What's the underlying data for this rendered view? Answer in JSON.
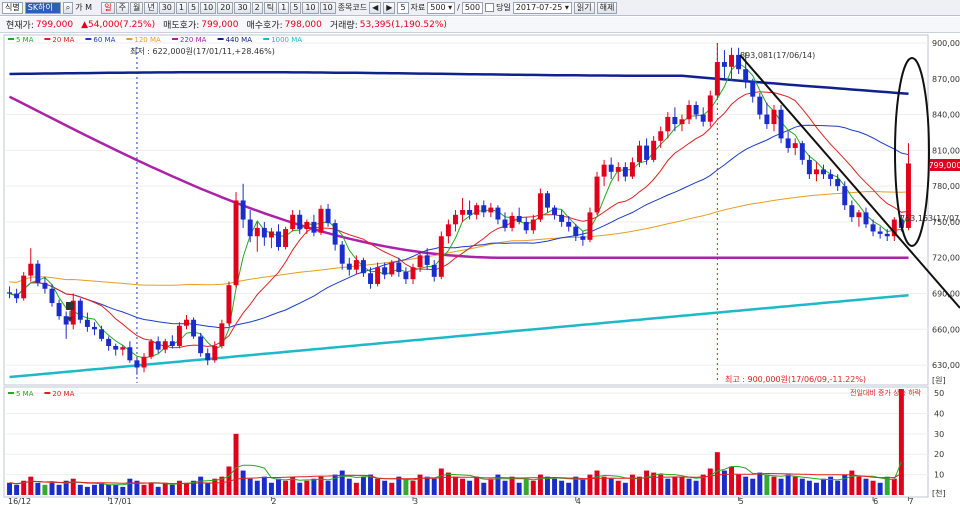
{
  "toolbar": {
    "code_label": "식별",
    "code_value": "SK하이",
    "name_short": "가 M",
    "periods": [
      "일",
      "주",
      "월",
      "년",
      "30",
      "1",
      "5",
      "10",
      "20",
      "30",
      "2",
      "틱",
      "1",
      "5",
      "10",
      "10"
    ],
    "stock_code_label": "종목코드",
    "count_value": "5",
    "data_label": "자료",
    "data_value": "500",
    "page_value": "500",
    "date_label": "당일",
    "date_value": "2017-07-25",
    "btn_save": "읽기",
    "btn_cancel": "해제"
  },
  "infobar": {
    "current_label": "현재가:",
    "current_value": "799,000",
    "change_value": "▲54,000(7.25%)",
    "ask_label": "매도호가:",
    "ask_value": "799,000",
    "bid_label": "매수호가:",
    "bid_value": "798,000",
    "volume_label": "거래량:",
    "volume_value": "53,395(1,190.52%)"
  },
  "legend_price": [
    {
      "label": "5 MA",
      "color": "#22aa22"
    },
    {
      "label": "20 MA",
      "color": "#dd2222"
    },
    {
      "label": "60 MA",
      "color": "#1a3cc8"
    },
    {
      "label": "120 MA",
      "color": "#e89c1f"
    },
    {
      "label": "220 MA",
      "color": "#aa22aa"
    },
    {
      "label": "440 MA",
      "color": "#10208e"
    },
    {
      "label": "1000 MA",
      "color": "#1fb8c8"
    }
  ],
  "legend_volume": [
    {
      "label": "5 MA",
      "color": "#22aa22"
    },
    {
      "label": "20 MA",
      "color": "#dd2222"
    }
  ],
  "annotations": {
    "low": "최저 : 622,000원(17/01/11,+28.46%)",
    "high": "최고 : 900,000원(17/06/09,-11.22%)",
    "peak_tag": "893,081(17/06/14)",
    "current_tag": "753,163(17/07/20)",
    "price_box": "799,000",
    "vol_unit": "[천]",
    "vol_header": "전일대비  증가  상승  하락",
    "price_unit": "[원]"
  },
  "chart_data": {
    "type": "candlestick",
    "y_axis": {
      "min": 615000,
      "max": 905000,
      "ticks": [
        900000,
        870000,
        840000,
        810000,
        780000,
        750000,
        720000,
        690000,
        660000,
        630000
      ]
    },
    "volume_axis": {
      "min": 0,
      "max": 52,
      "ticks": [
        50,
        40,
        30,
        20,
        10
      ]
    },
    "x_labels": [
      "16/12",
      "17/01",
      "2",
      "3",
      "4",
      "5",
      "6",
      "7"
    ],
    "ohlc": [
      [
        691000,
        696000,
        686000,
        690000
      ],
      [
        690000,
        694000,
        682000,
        686000
      ],
      [
        686000,
        708000,
        684000,
        705000
      ],
      [
        705000,
        728000,
        700000,
        715000
      ],
      [
        715000,
        718000,
        696000,
        699000
      ],
      [
        699000,
        704000,
        690000,
        694000
      ],
      [
        694000,
        698000,
        679000,
        682000
      ],
      [
        682000,
        685000,
        668000,
        671000
      ],
      [
        671000,
        675000,
        652000,
        664000
      ],
      [
        664000,
        690000,
        660000,
        684000
      ],
      [
        684000,
        686000,
        665000,
        668000
      ],
      [
        668000,
        674000,
        658000,
        662000
      ],
      [
        662000,
        666000,
        655000,
        660000
      ],
      [
        660000,
        663000,
        650000,
        652000
      ],
      [
        652000,
        654000,
        642000,
        646000
      ],
      [
        646000,
        648000,
        638000,
        643000
      ],
      [
        643000,
        647000,
        638000,
        645000
      ],
      [
        645000,
        650000,
        632000,
        634000
      ],
      [
        634000,
        637000,
        622000,
        628000
      ],
      [
        628000,
        640000,
        624000,
        637000
      ],
      [
        637000,
        652000,
        635000,
        650000
      ],
      [
        650000,
        654000,
        640000,
        643000
      ],
      [
        643000,
        652000,
        640000,
        650000
      ],
      [
        650000,
        655000,
        644000,
        646000
      ],
      [
        646000,
        666000,
        644000,
        663000
      ],
      [
        663000,
        672000,
        660000,
        668000
      ],
      [
        668000,
        670000,
        652000,
        654000
      ],
      [
        654000,
        657000,
        637000,
        640000
      ],
      [
        640000,
        644000,
        630000,
        634000
      ],
      [
        634000,
        650000,
        632000,
        646000
      ],
      [
        646000,
        668000,
        644000,
        665000
      ],
      [
        665000,
        700000,
        663000,
        697000
      ],
      [
        697000,
        775000,
        695000,
        768000
      ],
      [
        768000,
        782000,
        745000,
        752000
      ],
      [
        752000,
        760000,
        733000,
        738000
      ],
      [
        738000,
        750000,
        725000,
        745000
      ],
      [
        745000,
        750000,
        730000,
        737000
      ],
      [
        737000,
        745000,
        728000,
        742000
      ],
      [
        742000,
        748000,
        726000,
        729000
      ],
      [
        729000,
        746000,
        727000,
        744000
      ],
      [
        744000,
        760000,
        742000,
        756000
      ],
      [
        756000,
        760000,
        740000,
        744000
      ],
      [
        744000,
        752000,
        740000,
        750000
      ],
      [
        750000,
        756000,
        738000,
        741000
      ],
      [
        741000,
        764000,
        739000,
        761000
      ],
      [
        761000,
        765000,
        746000,
        749000
      ],
      [
        749000,
        752000,
        726000,
        731000
      ],
      [
        731000,
        734000,
        710000,
        715000
      ],
      [
        715000,
        720000,
        705000,
        710000
      ],
      [
        710000,
        722000,
        706000,
        718000
      ],
      [
        718000,
        720000,
        704000,
        707000
      ],
      [
        707000,
        712000,
        694000,
        698000
      ],
      [
        698000,
        716000,
        696000,
        712000
      ],
      [
        712000,
        716000,
        702000,
        706000
      ],
      [
        706000,
        718000,
        704000,
        716000
      ],
      [
        716000,
        720000,
        704000,
        708000
      ],
      [
        708000,
        712000,
        698000,
        702000
      ],
      [
        702000,
        715000,
        698000,
        712000
      ],
      [
        712000,
        725000,
        708000,
        722000
      ],
      [
        722000,
        728000,
        710000,
        714000
      ],
      [
        714000,
        718000,
        700000,
        704000
      ],
      [
        704000,
        742000,
        702000,
        738000
      ],
      [
        738000,
        752000,
        732000,
        748000
      ],
      [
        748000,
        760000,
        742000,
        756000
      ],
      [
        756000,
        770000,
        750000,
        760000
      ],
      [
        760000,
        768000,
        752000,
        756000
      ],
      [
        756000,
        766000,
        752000,
        764000
      ],
      [
        764000,
        768000,
        754000,
        758000
      ],
      [
        758000,
        766000,
        754000,
        762000
      ],
      [
        762000,
        764000,
        748000,
        752000
      ],
      [
        752000,
        758000,
        742000,
        745000
      ],
      [
        745000,
        758000,
        742000,
        755000
      ],
      [
        755000,
        762000,
        748000,
        750000
      ],
      [
        750000,
        754000,
        740000,
        743000
      ],
      [
        743000,
        756000,
        740000,
        752000
      ],
      [
        752000,
        778000,
        750000,
        774000
      ],
      [
        774000,
        776000,
        758000,
        762000
      ],
      [
        762000,
        764000,
        752000,
        756000
      ],
      [
        756000,
        760000,
        746000,
        750000
      ],
      [
        750000,
        755000,
        742000,
        746000
      ],
      [
        746000,
        748000,
        734000,
        738000
      ],
      [
        738000,
        742000,
        730000,
        735000
      ],
      [
        735000,
        762000,
        733000,
        758000
      ],
      [
        758000,
        792000,
        756000,
        788000
      ],
      [
        788000,
        802000,
        780000,
        798000
      ],
      [
        798000,
        804000,
        786000,
        792000
      ],
      [
        792000,
        800000,
        784000,
        796000
      ],
      [
        796000,
        800000,
        784000,
        788000
      ],
      [
        788000,
        804000,
        786000,
        800000
      ],
      [
        800000,
        818000,
        796000,
        814000
      ],
      [
        814000,
        820000,
        798000,
        802000
      ],
      [
        802000,
        822000,
        800000,
        818000
      ],
      [
        818000,
        830000,
        812000,
        826000
      ],
      [
        826000,
        842000,
        820000,
        838000
      ],
      [
        838000,
        846000,
        826000,
        832000
      ],
      [
        832000,
        840000,
        826000,
        836000
      ],
      [
        836000,
        852000,
        832000,
        848000
      ],
      [
        848000,
        851000,
        836000,
        840000
      ],
      [
        840000,
        846000,
        830000,
        834000
      ],
      [
        834000,
        860000,
        830000,
        856000
      ],
      [
        856000,
        900000,
        854000,
        884000
      ],
      [
        884000,
        894000,
        870000,
        880000
      ],
      [
        880000,
        896000,
        868000,
        890000
      ],
      [
        890000,
        896000,
        874000,
        878000
      ],
      [
        878000,
        892000,
        862000,
        868000
      ],
      [
        868000,
        870000,
        850000,
        855000
      ],
      [
        855000,
        858000,
        836000,
        840000
      ],
      [
        840000,
        850000,
        828000,
        832000
      ],
      [
        832000,
        848000,
        826000,
        844000
      ],
      [
        844000,
        848000,
        816000,
        820000
      ],
      [
        820000,
        826000,
        808000,
        812000
      ],
      [
        812000,
        820000,
        806000,
        816000
      ],
      [
        816000,
        818000,
        798000,
        802000
      ],
      [
        802000,
        806000,
        786000,
        790000
      ],
      [
        790000,
        800000,
        784000,
        794000
      ],
      [
        794000,
        798000,
        786000,
        790000
      ],
      [
        790000,
        794000,
        780000,
        786000
      ],
      [
        786000,
        790000,
        776000,
        780000
      ],
      [
        780000,
        784000,
        760000,
        764000
      ],
      [
        764000,
        768000,
        750000,
        754000
      ],
      [
        754000,
        760000,
        746000,
        758000
      ],
      [
        758000,
        762000,
        745000,
        748000
      ],
      [
        748000,
        752000,
        738000,
        742000
      ],
      [
        742000,
        746000,
        736000,
        740000
      ],
      [
        740000,
        744000,
        734000,
        738000
      ],
      [
        738000,
        754000,
        734000,
        752000
      ],
      [
        752000,
        756000,
        742000,
        745000
      ],
      [
        745000,
        816000,
        743000,
        799000
      ]
    ],
    "volume": [
      6,
      5,
      7,
      9,
      6,
      5,
      6,
      5,
      7,
      8,
      5,
      4,
      5,
      6,
      5,
      5,
      4,
      8,
      7,
      5,
      6,
      4,
      6,
      5,
      7,
      6,
      7,
      9,
      6,
      8,
      9,
      14,
      30,
      12,
      8,
      7,
      9,
      6,
      8,
      7,
      9,
      6,
      7,
      8,
      9,
      7,
      10,
      12,
      8,
      6,
      9,
      10,
      8,
      7,
      6,
      9,
      8,
      7,
      10,
      9,
      8,
      13,
      11,
      9,
      8,
      7,
      9,
      6,
      8,
      10,
      7,
      9,
      6,
      8,
      7,
      10,
      9,
      8,
      7,
      6,
      9,
      8,
      10,
      12,
      9,
      8,
      7,
      6,
      10,
      9,
      12,
      11,
      10,
      8,
      9,
      9,
      8,
      7,
      10,
      13,
      21,
      12,
      14,
      10,
      9,
      8,
      11,
      10,
      9,
      8,
      10,
      9,
      8,
      7,
      6,
      8,
      9,
      7,
      10,
      12,
      9,
      8,
      7,
      6,
      9,
      8,
      52
    ],
    "volume_red_idx": [
      2,
      3,
      9,
      19,
      20,
      22,
      24,
      25,
      29,
      30,
      31,
      32,
      39,
      40,
      42,
      44,
      49,
      52,
      54,
      57,
      58,
      61,
      62,
      63,
      64,
      66,
      68,
      71,
      74,
      75,
      82,
      83,
      84,
      86,
      88,
      89,
      90,
      91,
      92,
      94,
      95,
      98,
      99,
      100,
      102,
      103,
      108,
      111,
      119,
      120,
      122,
      125,
      126
    ],
    "ma": {
      "ma5_color": "#22aa22",
      "ma20_color": "#dd2222",
      "ma60_color": "#1a3cc8",
      "ma120_color": "#e89c1f",
      "ma220_color": "#aa22aa",
      "ma440_color": "#10208e",
      "ma1000_color": "#1fb8c8"
    }
  }
}
